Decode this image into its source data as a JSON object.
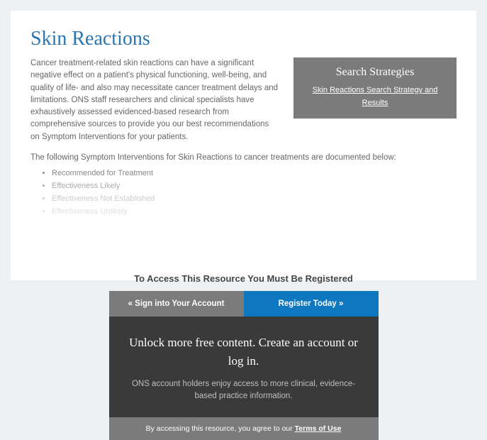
{
  "page": {
    "title": "Skin Reactions",
    "intro": "Cancer treatment-related skin reactions can have a significant negative effect on a patient's physical functioning, well-being, and quality of life- and also may necessitate cancer treatment delays and limitations. ONS staff researchers and clinical specialists have exhaustively assessed evidenced-based research from comprehensive sources to provide you our best recommendations on Symptom Interventions for your patients.",
    "subintro": "The following Symptom Interventions for Skin Reactions to cancer treatments are documented below:",
    "list": [
      "Recommended for Treatment",
      "Effectiveness Likely",
      "Effectiveness Not Established",
      "Effectiveness Unlikely"
    ]
  },
  "aside": {
    "title": "Search Strategies",
    "link": "Skin Reactions Search Strategy and Results"
  },
  "gate": {
    "title": "To Access This Resource You Must Be Registered",
    "signin": "« Sign into Your Account",
    "register": "Register Today »",
    "headline": "Unlock more free content. Create an account or log in.",
    "sub": "ONS account holders enjoy access to more clinical, evidence-based practice information.",
    "footer_pre": "By accessing this resource, you agree to our ",
    "terms": "Terms of Use"
  }
}
